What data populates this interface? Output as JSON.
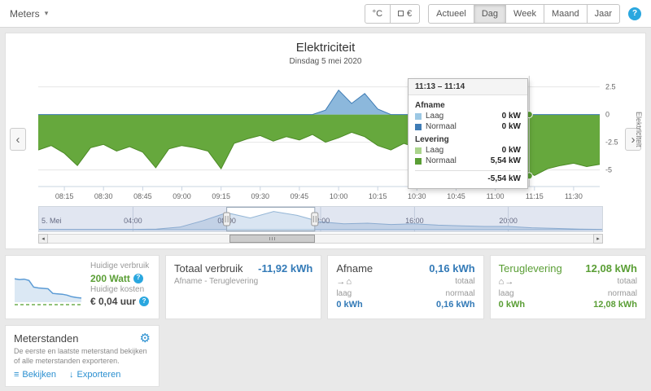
{
  "icons": {
    "caret_down": "▾",
    "chevron_left": "‹",
    "chevron_right": "›",
    "scroll_left": "◂",
    "scroll_right": "▸",
    "help": "?",
    "gear": "⚙",
    "list": "≡",
    "download": "↓",
    "house": "⌂",
    "arrow_right": "→"
  },
  "topbar": {
    "meters_label": "Meters",
    "temp_button": "°C",
    "currency_button": "€",
    "views": [
      "Actueel",
      "Dag",
      "Week",
      "Maand",
      "Jaar"
    ],
    "active_view": "Dag"
  },
  "chart": {
    "tooltip": {
      "header": "11:13 – 11:14",
      "sections": [
        {
          "title": "Afname",
          "rows": [
            {
              "swatch": "#9cc8e4",
              "label": "Laag",
              "value": "0 kW"
            },
            {
              "swatch": "#3f7cb5",
              "label": "Normaal",
              "value": "0 kW"
            }
          ]
        },
        {
          "title": "Levering",
          "rows": [
            {
              "swatch": "#abd48c",
              "label": "Laag",
              "value": "0 kW"
            },
            {
              "swatch": "#5a9e35",
              "label": "Normaal",
              "value": "5,54 kW"
            }
          ]
        }
      ],
      "total": "-5,54 kW"
    }
  },
  "chart_data": {
    "type": "area",
    "title": "Elektriciteit",
    "subtitle": "Dinsdag 5 mei 2020",
    "ylabel": "Elektriciteit",
    "unit": "kW",
    "x_start": "08:05",
    "x_step_minutes": 5,
    "x_ticks": [
      "08:15",
      "08:30",
      "08:45",
      "09:00",
      "09:15",
      "09:30",
      "09:45",
      "10:00",
      "10:15",
      "10:30",
      "10:45",
      "11:00",
      "11:15",
      "11:30"
    ],
    "y_ticks": [
      2.5,
      0,
      -2.5,
      -5
    ],
    "ylim": [
      3.5,
      -6.5
    ],
    "series": [
      {
        "name": "Levering (Normaal)",
        "color": "#4c8a26",
        "fill": "#66a83d",
        "values": [
          -3.2,
          -2.8,
          -3.5,
          -4.6,
          -3.0,
          -2.7,
          -3.3,
          -2.9,
          -3.4,
          -4.8,
          -3.1,
          -2.8,
          -3.0,
          -3.3,
          -4.9,
          -2.6,
          -2.2,
          -1.9,
          -2.4,
          -2.0,
          -2.3,
          -1.8,
          -2.5,
          -2.1,
          -1.6,
          -2.0,
          -2.8,
          -3.2,
          -2.6,
          -3.0,
          -3.4,
          -2.9,
          -4.2,
          -4.6,
          -4.3,
          -4.7,
          -4.4,
          -4.8,
          -5.5,
          -4.9,
          -4.6,
          -4.4,
          -4.7,
          -4.5
        ]
      },
      {
        "name": "Afname (Normaal)",
        "color": "#3f7cb5",
        "fill": "#8cb8dc",
        "values": [
          0,
          0,
          0,
          0,
          0,
          0,
          0,
          0,
          0,
          0,
          0,
          0,
          0,
          0,
          0,
          0,
          0,
          0,
          0,
          0,
          0,
          0,
          0.4,
          2.2,
          1.0,
          1.9,
          0.5,
          0,
          0,
          0,
          0,
          0,
          0,
          0,
          0,
          0,
          0,
          0,
          0,
          0,
          0,
          0,
          0,
          0
        ]
      }
    ],
    "crosshair": {
      "time": "11:13",
      "marker_values": [
        0,
        -5.54
      ],
      "marker_color": "#5a9e35"
    },
    "navigator": {
      "labels": [
        "5. Mei",
        "04:00",
        "08:00",
        "12:00",
        "16:00",
        "20:00"
      ],
      "label_fracs": [
        0.0,
        0.1667,
        0.3333,
        0.5,
        0.6667,
        0.8333
      ],
      "grid_fracs": [
        0.1667,
        0.3333,
        0.5,
        0.6667,
        0.8333
      ],
      "selection": [
        0.3333,
        0.4896
      ],
      "values": [
        0.05,
        0.05,
        0.05,
        0.05,
        0.05,
        0.1,
        0.4,
        1.4,
        2.6,
        1.8,
        2.8,
        2.2,
        1.2,
        0.9,
        1.0,
        0.8,
        0.9,
        0.7,
        0.6,
        0.5,
        0.5,
        0.3,
        0.2,
        0.1,
        0.05
      ]
    }
  },
  "cards": {
    "current": {
      "usage_label": "Huidige verbruik",
      "usage_value": "200 Watt",
      "cost_label": "Huidige kosten",
      "cost_value": "€ 0,04 uur",
      "spark_values": [
        430,
        420,
        425,
        410,
        330,
        320,
        315,
        310,
        255,
        250,
        245,
        235,
        215,
        205,
        200
      ]
    },
    "total": {
      "title": "Totaal verbruik",
      "value": "-11,92 kWh",
      "subtitle": "Afname - Teruglevering"
    },
    "afname": {
      "title": "Afname",
      "value": "0,16 kWh",
      "total_label": "totaal",
      "low_label": "laag",
      "normal_label": "normaal",
      "low_value": "0 kWh",
      "normal_value": "0,16 kWh"
    },
    "teruglevering": {
      "title": "Teruglevering",
      "value": "12,08 kWh",
      "total_label": "totaal",
      "low_label": "laag",
      "normal_label": "normaal",
      "low_value": "0 kWh",
      "normal_value": "12,08 kWh"
    },
    "meterstanden": {
      "title": "Meterstanden",
      "description": "De eerste en laatste meterstand bekijken of alle meterstanden exporteren.",
      "view_link": "Bekijken",
      "export_link": "Exporteren"
    }
  }
}
